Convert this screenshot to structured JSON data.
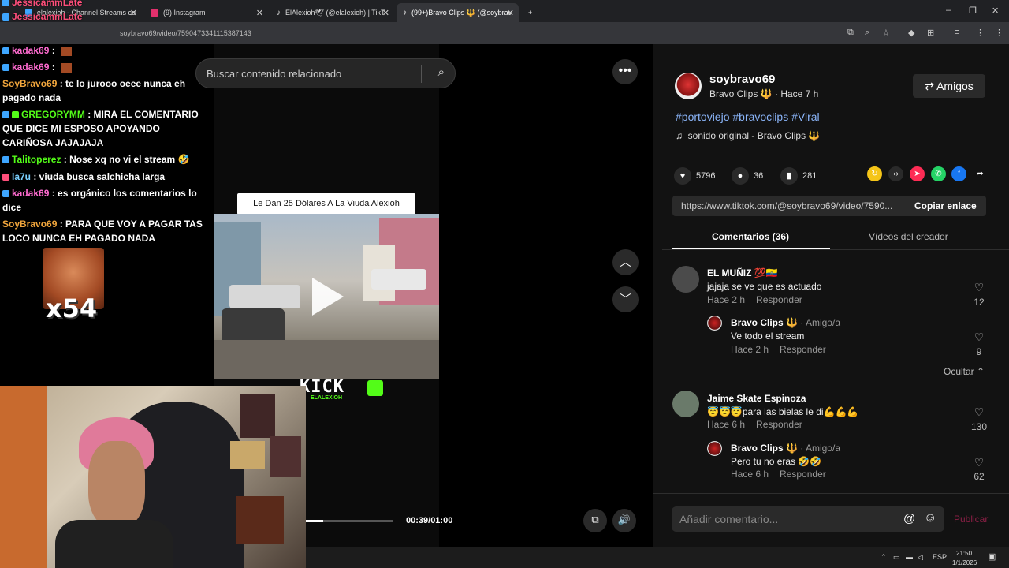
{
  "browser": {
    "tabs": [
      {
        "label": "elalexioh - Channel Streams co",
        "color": "#3ea6ff"
      },
      {
        "label": "(9) Instagram",
        "color": "#e1306c"
      },
      {
        "label": "ElAlexioh🕊 (@elalexioh) | TikT",
        "color": "#ffffff"
      },
      {
        "label": "(99+)Bravo Clips 🔱 (@soybrav",
        "color": "#ffffff"
      }
    ],
    "url": "soybravo69/video/7590473341115387143"
  },
  "video": {
    "search_placeholder": "Buscar contenido relacionado",
    "title_card": "Le Dan 25 Dólares A La Viuda Alexioh",
    "watermark": "KICK",
    "watermark_sub": "ELALEXIOH",
    "time": "00:39/01:00",
    "progress": 0.2
  },
  "chat": {
    "messages": [
      {
        "user": "JessicammLate",
        "text": "",
        "color": "#ff4f7b"
      },
      {
        "user": "JessicammLate",
        "text": "",
        "color": "#ff4f7b"
      },
      {
        "user": "kadak69",
        "text": " :",
        "color": "#ff6bd0"
      },
      {
        "user": "kadak69",
        "text": " :",
        "color": "#ff6bd0"
      },
      {
        "user": "SoyBravo69",
        "text": " : te lo jurooo oeee nunca eh pagado nada",
        "color": "#f0a53c"
      },
      {
        "user": "GREGORYMM",
        "text": " : MIRA EL COMENTARIO QUE DICE MI ESPOSO APOYANDO CARIÑOSA JAJAJAJA",
        "color": "#53fc18"
      },
      {
        "user": "Talitoperez",
        "text": " : Nose xq no vi el stream 🤣",
        "color": "#53fc18"
      },
      {
        "user": "la7u",
        "text": " : viuda busca salchicha larga",
        "color": "#7ad0ff"
      },
      {
        "user": "kadak69",
        "text": " : es orgánico los comentarios lo dice",
        "color": "#ff6bd0"
      },
      {
        "user": "SoyBravo69",
        "text": " : PARA QUE VOY A PAGAR TAS LOCO NUNCA EH PAGADO NADA",
        "color": "#f0a53c"
      }
    ],
    "emote_count": "x54"
  },
  "panel": {
    "username": "soybravo69",
    "display_name": "Bravo Clips 🔱",
    "posted": "· Hace 7 h",
    "follow_label": "Amigos",
    "hashtags": "#portoviejo #bravoclips #Viral",
    "sound": "sonido original - Bravo Clips 🔱",
    "stats": {
      "likes": "5796",
      "comments": "36",
      "saves": "281"
    },
    "link": "https://www.tiktok.com/@soybravo69/video/7590...",
    "copy_label": "Copiar enlace",
    "tab_comments": "Comentarios (36)",
    "tab_creator": "Vídeos del creador",
    "hide_label": "Ocultar ⌃",
    "comments": [
      {
        "name": "EL MUÑIZ 💯🇪🇨",
        "text": "jajaja se ve que es actuado",
        "time": "Hace 2 h",
        "reply": "Responder",
        "likes": "12"
      },
      {
        "name": "Bravo Clips 🔱",
        "tag": " · Amigo/a",
        "text": "Ve todo el stream",
        "time": "Hace 2 h",
        "reply": "Responder",
        "likes": "9"
      },
      {
        "name": "Jaime Skate Espinoza",
        "text": "😇😇😇para las bielas le di💪💪💪",
        "time": "Hace 6 h",
        "reply": "Responder",
        "likes": "130"
      },
      {
        "name": "Bravo Clips 🔱",
        "tag": " · Amigo/a",
        "text": "Pero tu no eras 🤣🤣",
        "time": "Hace 6 h",
        "reply": "Responder",
        "likes": "62"
      }
    ],
    "input_placeholder": "Añadir comentario...",
    "publish_label": "Publicar"
  },
  "taskbar": {
    "lang": "ESP",
    "time": "21:50",
    "date": "1/1/2026"
  }
}
